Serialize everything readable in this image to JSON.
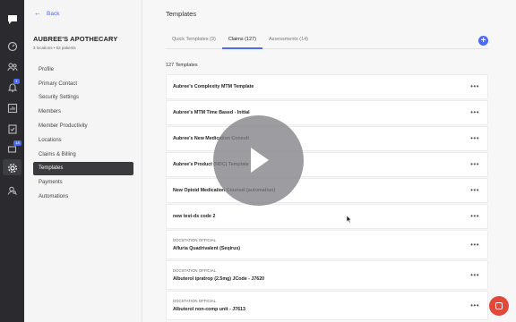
{
  "rail": {
    "badges": {
      "notifications": "1",
      "messages": "18"
    }
  },
  "sidebar": {
    "back_label": "Back",
    "org_name": "AUBREE'S APOTHECARY",
    "org_sub": "3 locations • 52 patients",
    "items": [
      {
        "label": "Profile"
      },
      {
        "label": "Primary Contact"
      },
      {
        "label": "Security Settings"
      },
      {
        "label": "Members"
      },
      {
        "label": "Member Productivity"
      },
      {
        "label": "Locations"
      },
      {
        "label": "Claims & Billing"
      },
      {
        "label": "Templates",
        "active": true
      },
      {
        "label": "Payments"
      },
      {
        "label": "Automations"
      }
    ]
  },
  "main": {
    "title": "Templates",
    "tabs": [
      {
        "label": "Quick Templates (3)"
      },
      {
        "label": "Claims (127)",
        "active": true
      },
      {
        "label": "Assessments (14)"
      }
    ],
    "add_label": "+",
    "count_label": "127 Templates",
    "rows": [
      {
        "source": "",
        "name": "Aubree's Complexity MTM Template"
      },
      {
        "source": "",
        "name": "Aubree's MTM Time Based - Initial"
      },
      {
        "source": "",
        "name": "Aubree's New Medication Consult"
      },
      {
        "source": "",
        "name": "Aubree's Product (NDC) Template"
      },
      {
        "source": "",
        "name": "New Opioid Medication Counsel (automation)"
      },
      {
        "source": "",
        "name": "new test-dx code 2"
      },
      {
        "source": "DOCSTATION OFFICIAL",
        "name": "Afluria Quadrivalent (Seqirus)"
      },
      {
        "source": "DOCSTATION OFFICIAL",
        "name": "Albuterol ipratrop (2.5mg) JCode - J7620"
      },
      {
        "source": "DOCSTATION OFFICIAL",
        "name": "Albuterol non-comp unit - J7613"
      }
    ],
    "menu_glyph": "•••"
  },
  "colors": {
    "accent": "#4a6cf7",
    "rail_bg": "#2b2b2f",
    "chat": "#e2493b"
  }
}
